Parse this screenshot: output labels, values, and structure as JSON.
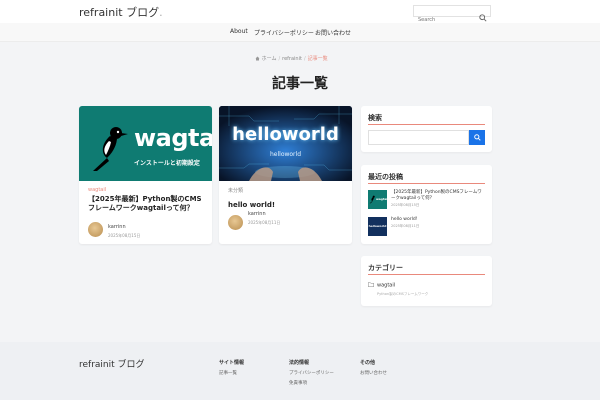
{
  "header": {
    "logo": "refrainit ブログ",
    "logo_dot": ".",
    "search_placeholder": "Search"
  },
  "nav": {
    "items": [
      {
        "label": "About"
      },
      {
        "label": "プライバシーポリシー"
      },
      {
        "label": "お問い合わせ"
      }
    ]
  },
  "breadcrumb": {
    "home": "ホーム",
    "sep": "/",
    "middle": "refrainit",
    "current": "記事一覧"
  },
  "page_title": "記事一覧",
  "cards": [
    {
      "thumb_logo": "wagtail",
      "thumb_subtitle": "インストールと初期設定",
      "category": "wagtail",
      "title": "【2025年最新】Python製のCMSフレームワークwagtailって何？",
      "author": "karrinn",
      "date": "2025年08月15日"
    },
    {
      "thumb_main": "helloworld",
      "thumb_small": "helloworld",
      "category": "未分類",
      "title": "hello world!",
      "author": "karrinn",
      "date": "2025年08月11日"
    }
  ],
  "sidebar": {
    "search": {
      "title": "検索"
    },
    "recent": {
      "title": "最近の投稿",
      "posts": [
        {
          "title": "【2025年最新】Python製のCMSフレームワークwagtailって何？",
          "date": "2025年08月15日",
          "thumb_text": "wagtail"
        },
        {
          "title": "hello world!",
          "date": "2025年08月11日",
          "thumb_text": "helloworld"
        }
      ]
    },
    "categories": {
      "title": "カテゴリー",
      "items": [
        {
          "name": "wagtail",
          "desc": "Python製のCMSフレームワーク"
        }
      ]
    }
  },
  "footer": {
    "logo": "refrainit ブログ",
    "columns": [
      {
        "heading": "サイト情報",
        "links": [
          "記事一覧"
        ]
      },
      {
        "heading": "法的情報",
        "links": [
          "プライバシーポリシー",
          "免責事項"
        ]
      },
      {
        "heading": "その他",
        "links": [
          "お問い合わせ"
        ]
      }
    ]
  },
  "colors": {
    "accent": "#e9897c",
    "search_button": "#1a73e8",
    "wagtail_bg": "#0f7b72",
    "hello_bg": "#0a1a3a"
  }
}
